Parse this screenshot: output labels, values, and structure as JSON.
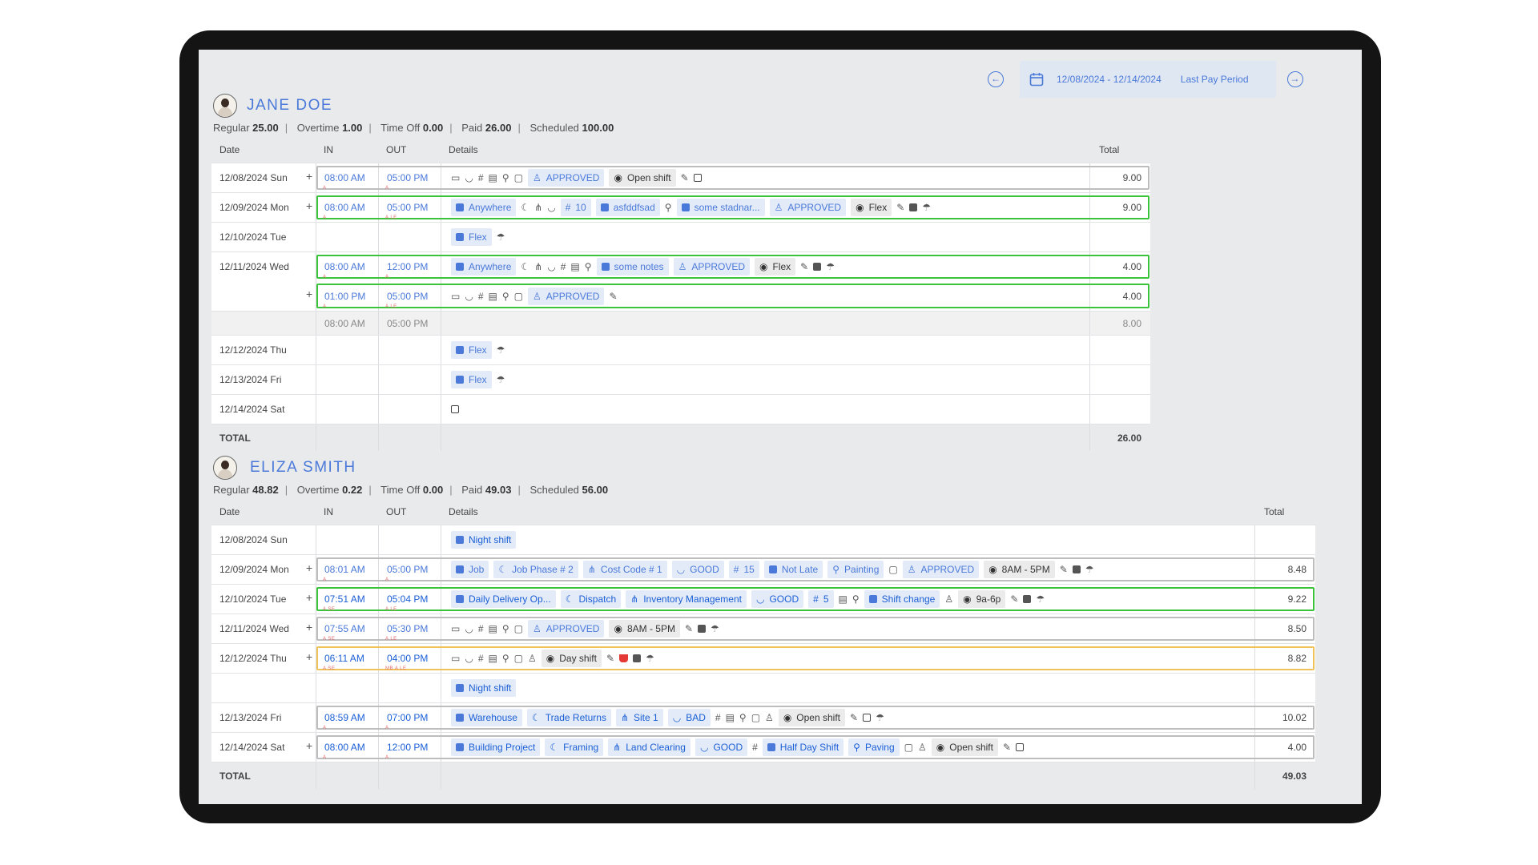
{
  "period": {
    "range": "12/08/2024 - 12/14/2024",
    "label": "Last Pay Period"
  },
  "employees": [
    {
      "name": "JANE DOE",
      "stats": {
        "regular_label": "Regular",
        "regular": "25.00",
        "overtime_label": "Overtime",
        "overtime": "1.00",
        "timeoff_label": "Time Off",
        "timeoff": "0.00",
        "paid_label": "Paid",
        "paid": "26.00",
        "scheduled_label": "Scheduled",
        "scheduled": "100.00"
      },
      "headers": {
        "date": "Date",
        "in": "IN",
        "out": "OUT",
        "details": "Details",
        "total": "Total"
      },
      "rows": [
        {
          "date": "12/08/2024 Sun",
          "in": "08:00 AM",
          "out": "05:00 PM",
          "approved": "APPROVED",
          "shift": "Open shift",
          "total": "9.00"
        },
        {
          "date": "12/09/2024 Mon",
          "in": "08:00 AM",
          "out": "05:00 PM",
          "location": "Anywhere",
          "code": "10",
          "doc": "asfddfsad",
          "note": "some stadnar...",
          "approved": "APPROVED",
          "shift": "Flex",
          "total": "9.00"
        },
        {
          "date": "12/10/2024 Tue",
          "shift": "Flex"
        },
        {
          "date": "12/11/2024 Wed",
          "in": "08:00 AM",
          "out": "12:00 PM",
          "location": "Anywhere",
          "note": "some notes",
          "approved": "APPROVED",
          "shift": "Flex",
          "total": "4.00"
        },
        {
          "in": "01:00 PM",
          "out": "05:00 PM",
          "approved": "APPROVED",
          "total": "4.00"
        },
        {
          "in": "08:00 AM",
          "out": "05:00 PM",
          "total": "8.00"
        },
        {
          "date": "12/12/2024 Thu",
          "shift": "Flex"
        },
        {
          "date": "12/13/2024 Fri",
          "shift": "Flex"
        },
        {
          "date": "12/14/2024 Sat"
        }
      ],
      "total_label": "TOTAL",
      "total": "26.00"
    },
    {
      "name": "ELIZA SMITH",
      "stats": {
        "regular_label": "Regular",
        "regular": "48.82",
        "overtime_label": "Overtime",
        "overtime": "0.22",
        "timeoff_label": "Time Off",
        "timeoff": "0.00",
        "paid_label": "Paid",
        "paid": "49.03",
        "scheduled_label": "Scheduled",
        "scheduled": "56.00"
      },
      "headers": {
        "date": "Date",
        "in": "IN",
        "out": "OUT",
        "details": "Details",
        "total": "Total"
      },
      "rows": [
        {
          "date": "12/08/2024 Sun",
          "shift": "Night shift"
        },
        {
          "date": "12/09/2024 Mon",
          "in": "08:01 AM",
          "out": "05:00 PM",
          "job": "Job",
          "phase": "Job Phase # 2",
          "cost": "Cost Code # 1",
          "rating": "GOOD",
          "code": "15",
          "doc": "Not Late",
          "task": "Painting",
          "approved": "APPROVED",
          "shift": "8AM - 5PM",
          "total": "8.48"
        },
        {
          "date": "12/10/2024 Tue",
          "in": "07:51 AM",
          "out": "05:04 PM",
          "job": "Daily Delivery Op...",
          "phase": "Dispatch",
          "cost": "Inventory Management",
          "rating": "GOOD",
          "code": "5",
          "note": "Shift change",
          "shift": "9a-6p",
          "total": "9.22"
        },
        {
          "date": "12/11/2024 Wed",
          "in": "07:55 AM",
          "out": "05:30 PM",
          "approved": "APPROVED",
          "shift": "8AM - 5PM",
          "total": "8.50"
        },
        {
          "date": "12/12/2024 Thu",
          "in": "06:11 AM",
          "out": "04:00 PM",
          "shift": "Day shift",
          "total": "8.82"
        },
        {
          "shift": "Night shift"
        },
        {
          "date": "12/13/2024 Fri",
          "in": "08:59 AM",
          "out": "07:00 PM",
          "job": "Warehouse",
          "phase": "Trade Returns",
          "cost": "Site 1",
          "rating": "BAD",
          "shift": "Open shift",
          "total": "10.02"
        },
        {
          "date": "12/14/2024 Sat",
          "in": "08:00 AM",
          "out": "12:00 PM",
          "job": "Building Project",
          "phase": "Framing",
          "cost": "Land Clearing",
          "rating": "GOOD",
          "doc": "Half Day Shift",
          "task": "Paving",
          "shift": "Open shift",
          "total": "4.00"
        }
      ],
      "total_label": "TOTAL",
      "total": "49.03"
    }
  ],
  "flags": {
    "a": "A",
    "ase": "A SE",
    "ale": "A LE",
    "mbale": "MB A LE"
  },
  "icons": [
    "arrow-left-circle-icon",
    "calendar-icon",
    "arrow-right-circle-icon",
    "briefcase-icon",
    "moon-icon",
    "branch-icon",
    "badge-icon",
    "hash-icon",
    "document-icon",
    "tool-icon",
    "note-icon",
    "stamp-icon",
    "eye-icon",
    "edit-icon",
    "calendar-small-icon",
    "umbrella-icon",
    "coffee-icon"
  ],
  "colors": {
    "accent": "#4a79d9",
    "approved_frame": "#3cc33c",
    "warning_frame": "#f0c35a",
    "default_frame": "#bdbdbd",
    "break": "#e53935"
  }
}
